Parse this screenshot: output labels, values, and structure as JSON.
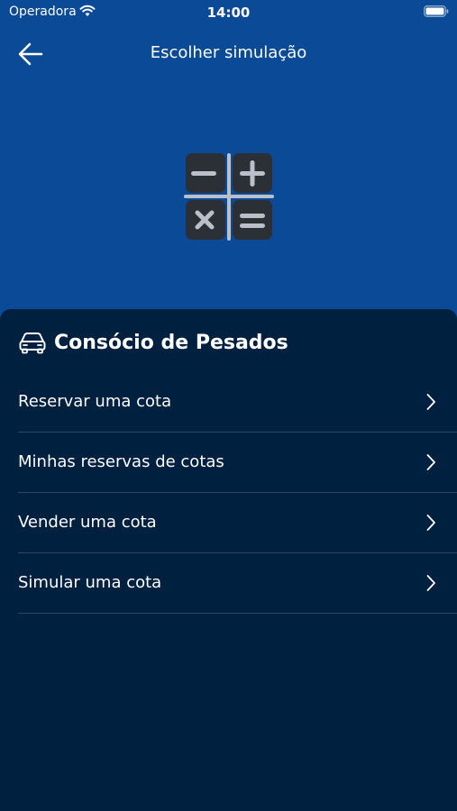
{
  "status_bar": {
    "carrier": "Operadora",
    "time": "14:00",
    "wifi_icon": "wifi-icon",
    "battery_icon": "battery-icon"
  },
  "nav": {
    "title": "Escolher simulação",
    "back_icon": "arrow-left-icon"
  },
  "hero": {
    "icon": "calculator-icon"
  },
  "section": {
    "icon": "car-icon",
    "title": "Consócio de Pesados"
  },
  "menu": {
    "items": [
      {
        "label": "Reservar uma cota"
      },
      {
        "label": "Minhas reservas de cotas"
      },
      {
        "label": "Vender uma cota"
      },
      {
        "label": "Simular uma cota"
      }
    ],
    "chevron_icon": "chevron-right-icon"
  },
  "colors": {
    "header_bg": "#0a4a96",
    "sheet_bg": "#00203f",
    "divider": "#2b4663",
    "text": "#ffffff"
  }
}
